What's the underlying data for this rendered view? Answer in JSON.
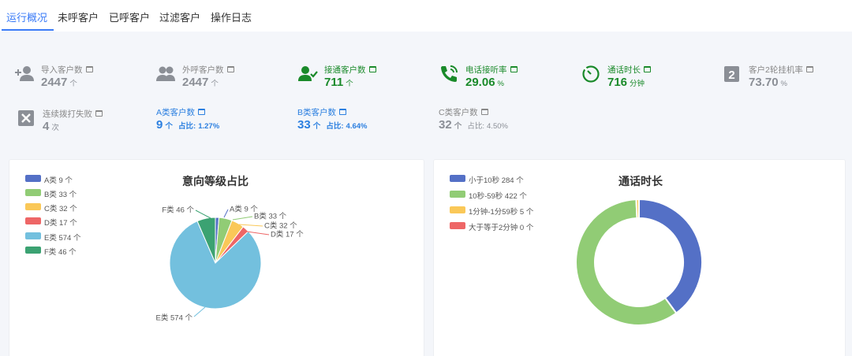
{
  "tabs": [
    {
      "label": "运行概况",
      "active": true
    },
    {
      "label": "未呼客户",
      "active": false
    },
    {
      "label": "已呼客户",
      "active": false
    },
    {
      "label": "过滤客户",
      "active": false
    },
    {
      "label": "操作日志",
      "active": false
    }
  ],
  "colors": {
    "accent": "#3a7bf7",
    "green": "#1a8a2a",
    "blue": "#2b7fe0",
    "grey": "#8b8f96"
  },
  "stats": {
    "imported": {
      "label": "导入客户数",
      "value": "2447",
      "unit": "个",
      "icon": "add-user-icon"
    },
    "called": {
      "label": "外呼客户数",
      "value": "2447",
      "unit": "个",
      "icon": "group-icon"
    },
    "connected": {
      "label": "接通客户数",
      "value": "711",
      "unit": "个",
      "icon": "user-check-icon"
    },
    "answer_rate": {
      "label": "电话接听率",
      "value": "29.06",
      "unit": "%",
      "icon": "phone-call-icon"
    },
    "duration": {
      "label": "通话时长",
      "value": "716",
      "unit": "分钟",
      "icon": "timer-icon"
    },
    "round2_hangup": {
      "label": "客户2轮挂机率",
      "value": "73.70",
      "unit": "%",
      "icon": "number-2-icon"
    },
    "dial_fail": {
      "label": "连续拨打失败",
      "value": "4",
      "unit": "次",
      "icon": "close-box-icon"
    },
    "class_a": {
      "label": "A类客户数",
      "value": "9",
      "unit": "个",
      "ratio_label": "占比:",
      "ratio": "1.27%"
    },
    "class_b": {
      "label": "B类客户数",
      "value": "33",
      "unit": "个",
      "ratio_label": "占比:",
      "ratio": "4.64%"
    },
    "class_c": {
      "label": "C类客户数",
      "value": "32",
      "unit": "个",
      "ratio_label": "占比:",
      "ratio": "4.50%"
    }
  },
  "chart_data": [
    {
      "type": "pie",
      "title": "意向等级占比",
      "legend_position": "top-left",
      "categories": [
        "A类",
        "B类",
        "C类",
        "D类",
        "E类",
        "F类"
      ],
      "values": [
        9,
        33,
        32,
        17,
        574,
        46
      ],
      "unit": "个",
      "colors": [
        "#5470c6",
        "#91cc75",
        "#fac858",
        "#ee6666",
        "#73c0de",
        "#3ba272"
      ],
      "legend": [
        "A类 9 个",
        "B类 33 个",
        "C类 32 个",
        "D类 17 个",
        "E类 574 个",
        "F类 46 个"
      ],
      "slice_labels": [
        "A类 9 个",
        "B类 33 个",
        "C类 32 个",
        "D类 17 个",
        "E类 574 个",
        "F类 46 个"
      ]
    },
    {
      "type": "donut",
      "title": "通话时长",
      "legend_position": "top-left",
      "categories": [
        "小于10秒",
        "10秒-59秒",
        "1分钟-1分59秒",
        "大于等于2分钟"
      ],
      "values": [
        284,
        422,
        5,
        0
      ],
      "unit": "个",
      "colors": [
        "#5470c6",
        "#91cc75",
        "#fac858",
        "#ee6666"
      ],
      "legend": [
        "小于10秒 284 个",
        "10秒-59秒 422 个",
        "1分钟-1分59秒 5 个",
        "大于等于2分钟 0 个"
      ]
    }
  ]
}
